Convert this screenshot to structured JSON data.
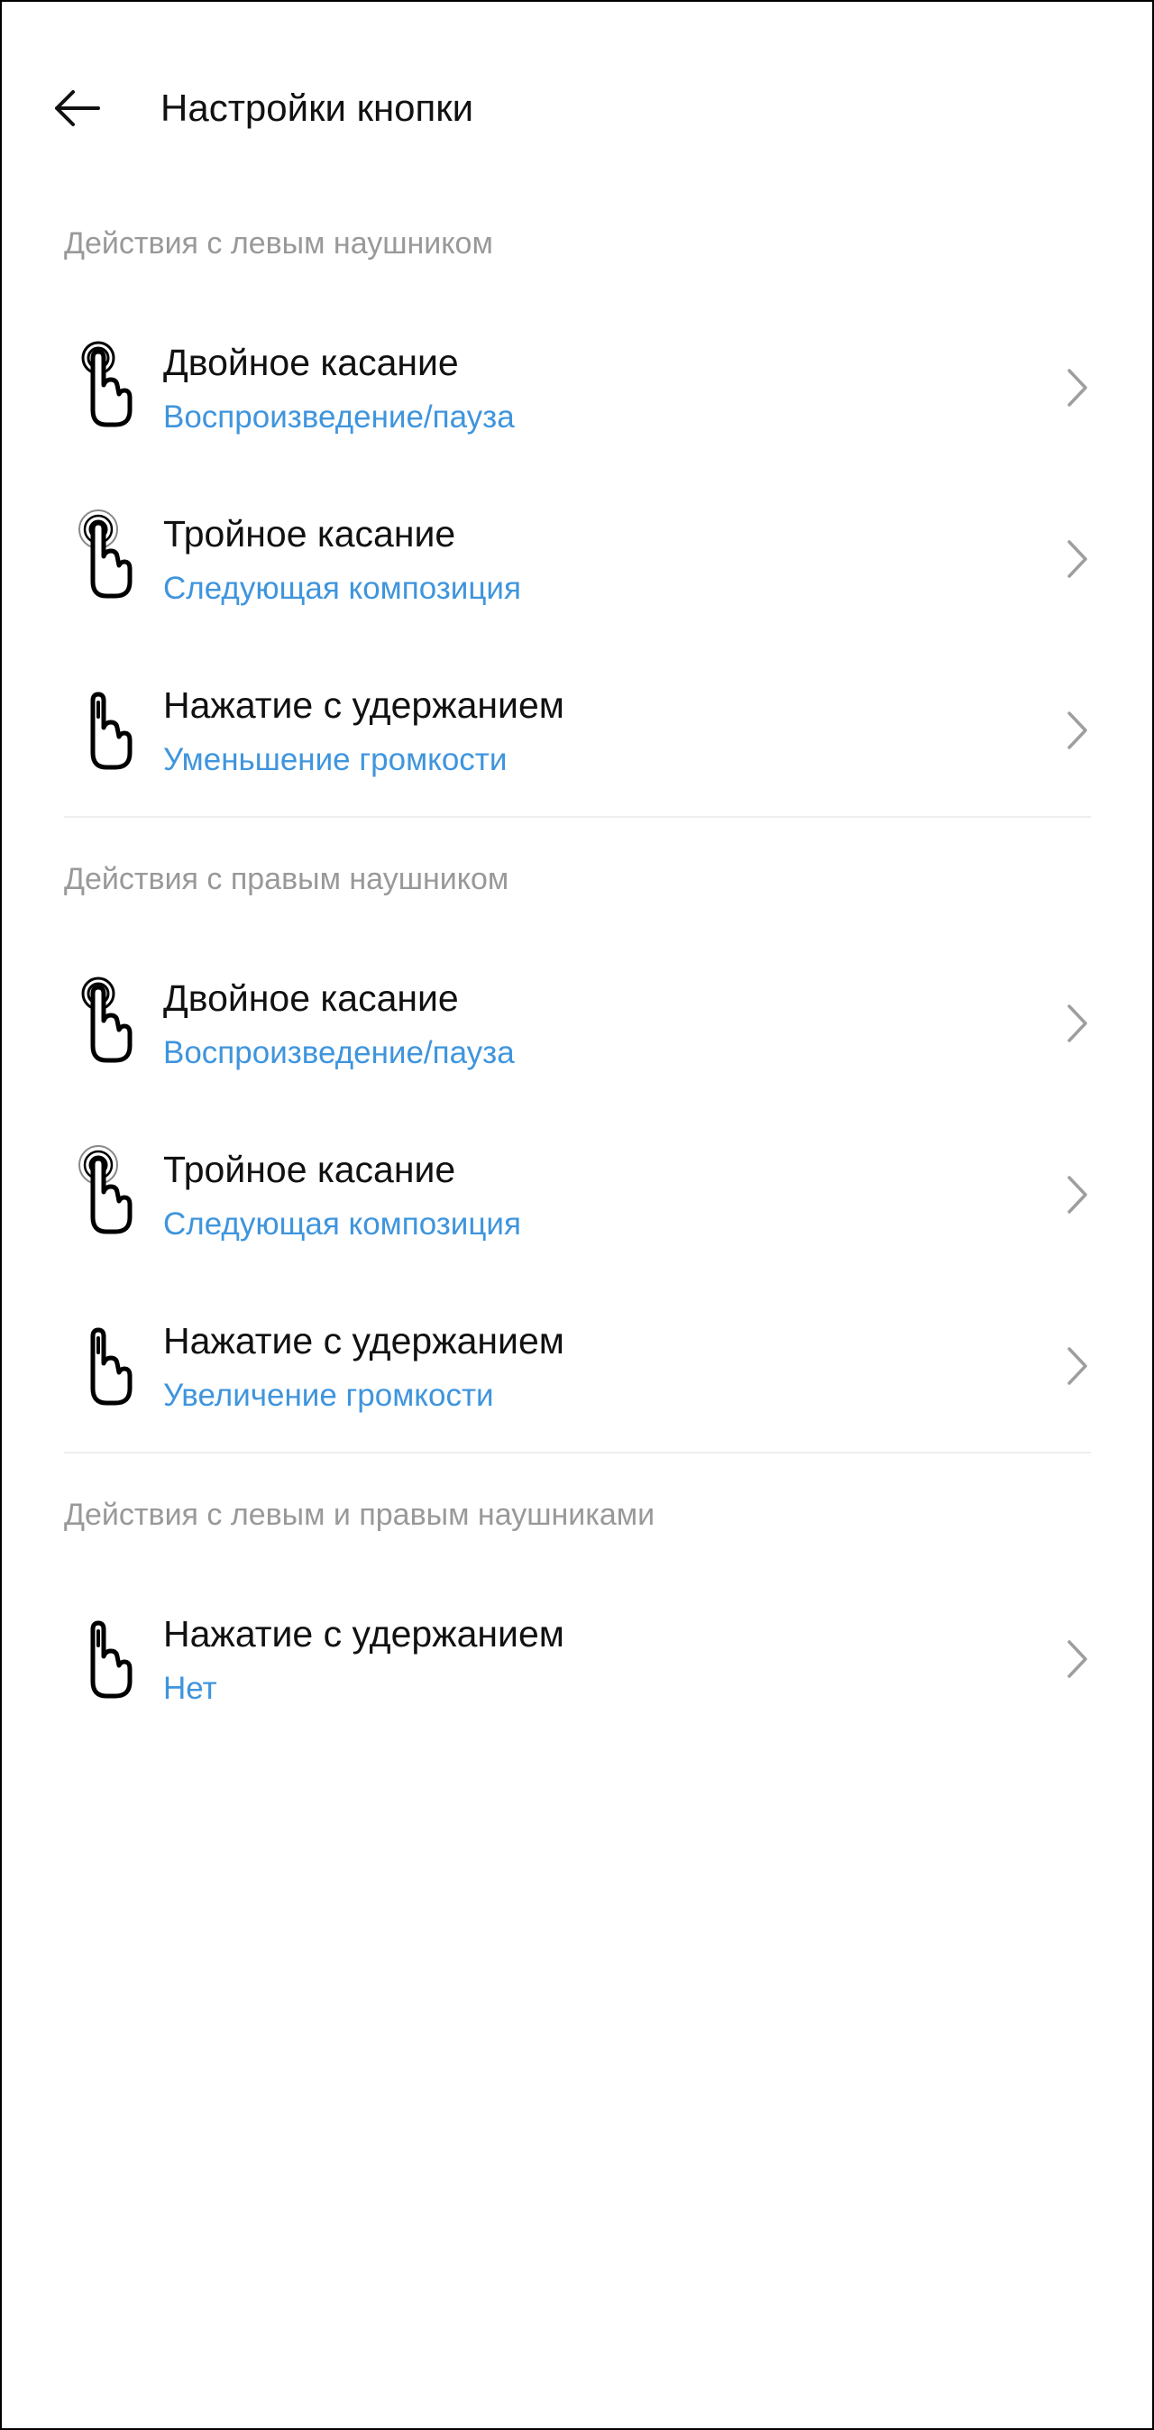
{
  "header": {
    "back_icon": "arrow-left-icon",
    "title": "Настройки кнопки"
  },
  "sections": [
    {
      "title": "Действия с левым наушником",
      "items": [
        {
          "icon": "double-tap-icon",
          "title": "Двойное касание",
          "value": "Воспроизведение/пауза"
        },
        {
          "icon": "triple-tap-icon",
          "title": "Тройное касание",
          "value": "Следующая композиция"
        },
        {
          "icon": "press-hold-icon",
          "title": "Нажатие с удержанием",
          "value": "Уменьшение громкости"
        }
      ]
    },
    {
      "title": "Действия с правым наушником",
      "items": [
        {
          "icon": "double-tap-icon",
          "title": "Двойное касание",
          "value": "Воспроизведение/пауза"
        },
        {
          "icon": "triple-tap-icon",
          "title": "Тройное касание",
          "value": "Следующая композиция"
        },
        {
          "icon": "press-hold-icon",
          "title": "Нажатие с удержанием",
          "value": "Увеличение громкости"
        }
      ]
    },
    {
      "title": "Действия с левым и правым наушниками",
      "items": [
        {
          "icon": "press-hold-icon",
          "title": "Нажатие с удержанием",
          "value": "Нет"
        }
      ]
    }
  ],
  "colors": {
    "background": "#ffffff",
    "title_text": "#111111",
    "section_header": "#999999",
    "value_accent": "#3f95dd",
    "chevron": "#9e9e9e",
    "divider": "#eeeeee"
  }
}
